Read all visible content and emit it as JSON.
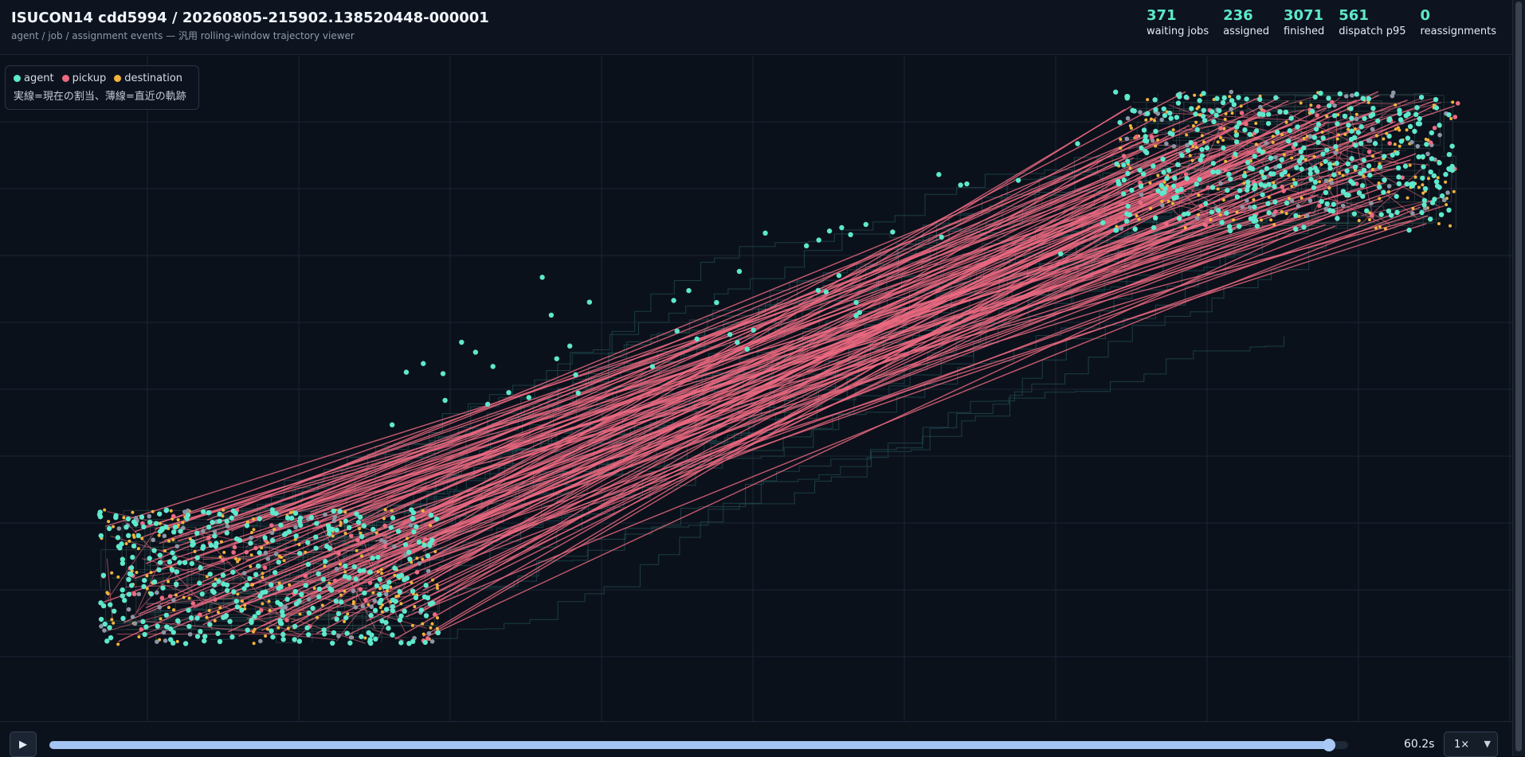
{
  "header": {
    "title": "ISUCON14 cdd5994 / 20260805-215902.138520448-000001",
    "subtitle": "agent / job / assignment events — 汎用 rolling-window trajectory viewer"
  },
  "stats": [
    {
      "value": "371",
      "label": "waiting jobs"
    },
    {
      "value": "236",
      "label": "assigned"
    },
    {
      "value": "3071",
      "label": "finished"
    },
    {
      "value": "561",
      "label": "dispatch p95"
    },
    {
      "value": "0",
      "label": "reassignments"
    }
  ],
  "legend": {
    "items": [
      {
        "label": "agent",
        "color": "#5ee8cc"
      },
      {
        "label": "pickup",
        "color": "#ee6a82"
      },
      {
        "label": "destination",
        "color": "#f2b43c"
      }
    ],
    "note": "実線=現在の割当、薄線=直近の軌跡"
  },
  "colors": {
    "agent": "#5ee8cc",
    "pickup": "#ee6a82",
    "destination": "#f2b43c",
    "idle": "#8e96a6",
    "trail": "#1f4a4d",
    "grid": "#1a2534"
  },
  "controls": {
    "play_icon": "▶",
    "time": "60.2s",
    "speed": "1×",
    "progress": 0.985
  }
}
